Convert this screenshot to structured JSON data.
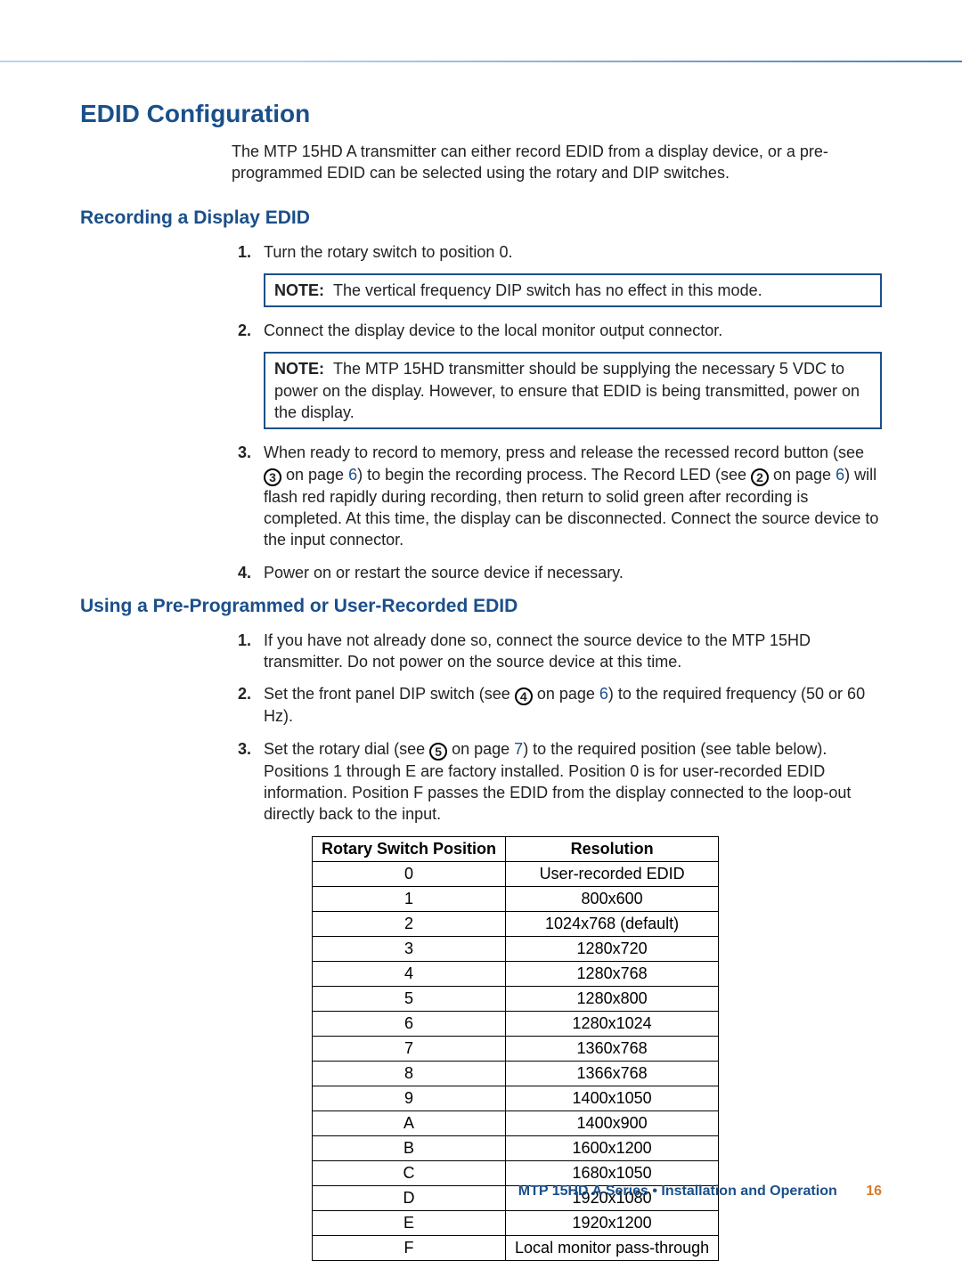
{
  "h1": "EDID Configuration",
  "intro": "The MTP 15HD A transmitter can either record EDID from a display device, or a pre-programmed EDID can be selected using the rotary and DIP switches.",
  "section1": {
    "title": "Recording a Display EDID",
    "steps": {
      "s1_num": "1.",
      "s1_txt": "Turn the rotary switch to position 0.",
      "note1_lbl": "NOTE:",
      "note1_txt": "The vertical frequency DIP switch has no effect in this mode.",
      "s2_num": "2.",
      "s2_txt": "Connect the display device to the local monitor output connector.",
      "note2_lbl": "NOTE:",
      "note2_txt": "The MTP 15HD transmitter should be supplying the necessary 5 VDC to power on the display. However, to ensure that EDID is being transmitted, power on the display.",
      "s3_num": "3.",
      "s3_a": "When ready to record to memory, press and release the recessed record button (see ",
      "s3_c3": "3",
      "s3_b": " on page ",
      "s3_link1": "6",
      "s3_c": ") to begin the recording process. The Record LED (see ",
      "s3_c2": "2",
      "s3_d": " on page ",
      "s3_link2": "6",
      "s3_e": ") will flash red rapidly during recording, then return to solid green after recording is completed. At this time, the display can be disconnected. Connect the source device to the input connector.",
      "s4_num": "4.",
      "s4_txt": "Power on or restart the source device if necessary."
    }
  },
  "section2": {
    "title": "Using a Pre-Programmed or User-Recorded EDID",
    "s1_num": "1.",
    "s1_txt": "If you have not already done so, connect the source device to the MTP 15HD transmitter. Do not power on the source device at this time.",
    "s2_num": "2.",
    "s2_a": "Set the front panel DIP switch (see ",
    "s2_c4": "4",
    "s2_b": " on page ",
    "s2_link": "6",
    "s2_c": ") to the required frequency (50 or 60 Hz).",
    "s3_num": "3.",
    "s3_a": "Set the rotary dial (see ",
    "s3_c5": "5",
    "s3_b": " on page ",
    "s3_link": "7",
    "s3_c": ") to the required position (see table below). Positions 1 through E are factory installed. Position 0 is for user-recorded EDID information. Position F passes the EDID from the display connected to the loop-out directly back to the input."
  },
  "table": {
    "h1": "Rotary Switch Position",
    "h2": "Resolution",
    "rows": [
      {
        "p": "0",
        "r": "User-recorded EDID"
      },
      {
        "p": "1",
        "r": "800x600"
      },
      {
        "p": "2",
        "r": "1024x768 (default)"
      },
      {
        "p": "3",
        "r": "1280x720"
      },
      {
        "p": "4",
        "r": "1280x768"
      },
      {
        "p": "5",
        "r": "1280x800"
      },
      {
        "p": "6",
        "r": "1280x1024"
      },
      {
        "p": "7",
        "r": "1360x768"
      },
      {
        "p": "8",
        "r": "1366x768"
      },
      {
        "p": "9",
        "r": "1400x1050"
      },
      {
        "p": "A",
        "r": "1400x900"
      },
      {
        "p": "B",
        "r": "1600x1200"
      },
      {
        "p": "C",
        "r": "1680x1050"
      },
      {
        "p": "D",
        "r": "1920x1080"
      },
      {
        "p": "E",
        "r": "1920x1200"
      },
      {
        "p": "F",
        "r": "Local monitor pass-through"
      }
    ]
  },
  "footer": {
    "text": "MTP 15HD A Series • Installation and Operation",
    "page": "16"
  }
}
